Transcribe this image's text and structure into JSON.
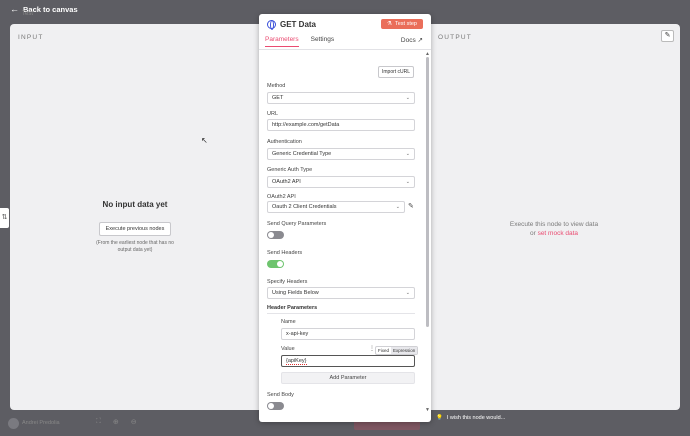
{
  "topbar": {
    "back_label": "Back to canvas",
    "ghost_title": "Test"
  },
  "input_panel": {
    "label": "INPUT",
    "empty_title": "No input data yet",
    "execute_prev_label": "Execute previous nodes",
    "hint": "(From the earliest node that has no output data yet)"
  },
  "output_panel": {
    "label": "OUTPUT",
    "message": "Execute this node to view data",
    "or_text": "or",
    "mock_link": "set mock data"
  },
  "node": {
    "title": "GET Data",
    "test_step_label": "Test step",
    "tabs": [
      "Parameters",
      "Settings"
    ],
    "docs_label": "Docs",
    "import_curl_label": "Import cURL",
    "method": {
      "label": "Method",
      "value": "GET"
    },
    "url": {
      "label": "URL",
      "value": "http://example.com/getData"
    },
    "authentication": {
      "label": "Authentication",
      "value": "Generic Credential Type"
    },
    "generic_auth": {
      "label": "Generic Auth Type",
      "value": "OAuth2 API"
    },
    "oauth2": {
      "label": "OAuth2 API",
      "value": "Oauth 2 Client Credentials"
    },
    "send_query": {
      "label": "Send Query Parameters",
      "on": false
    },
    "send_headers": {
      "label": "Send Headers",
      "on": true
    },
    "specify_headers": {
      "label": "Specify Headers",
      "value": "Using Fields Below"
    },
    "header_params": {
      "title": "Header Parameters",
      "name_label": "Name",
      "name_value": "x-api-key",
      "value_label": "Value",
      "value_value": "{apiKey}",
      "mode_fixed": "Fixed",
      "mode_expression": "Expression",
      "add_label": "Add Parameter"
    },
    "send_body": {
      "label": "Send Body",
      "on": false
    }
  },
  "bottombar": {
    "user_name": "Andrei Predolia",
    "feedback": "I wish this node would..."
  },
  "colors": {
    "accent": "#ea4b71",
    "test_button": "#ea6e5a",
    "toggle_on": "#6ec46e"
  }
}
